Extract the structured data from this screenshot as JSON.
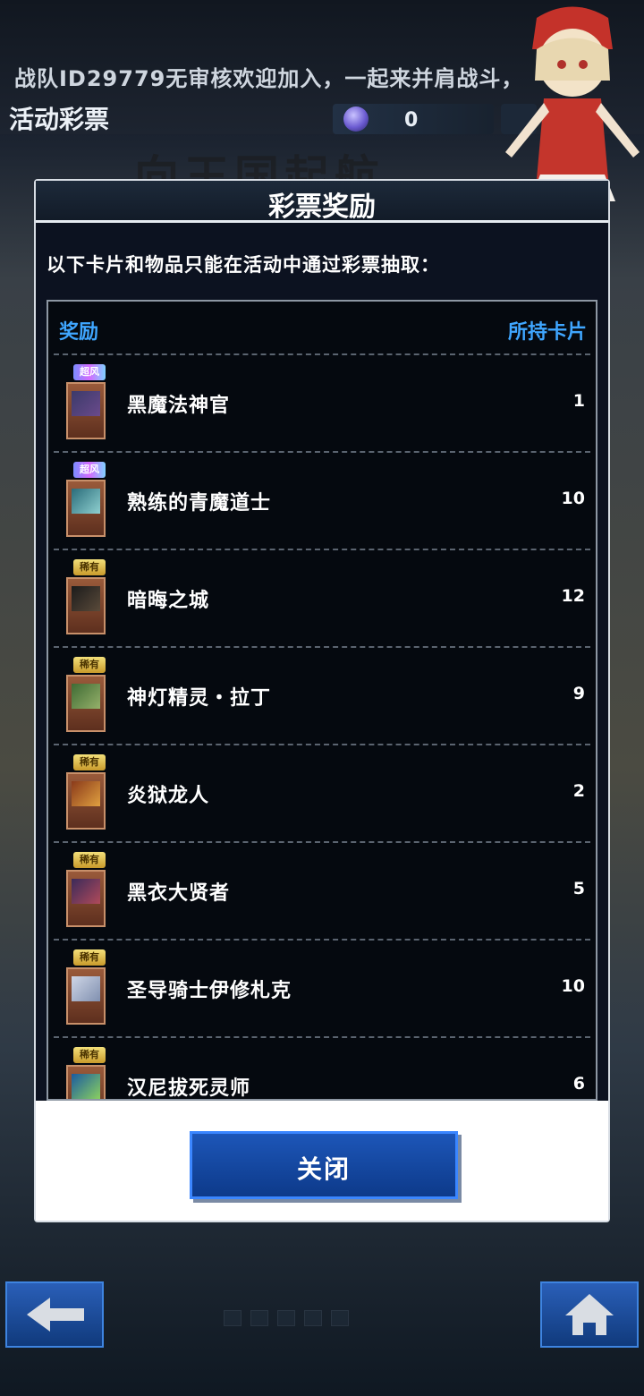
{
  "header": {
    "marquee": "战队ID29779无审核欢迎加入，一起来并肩战斗，",
    "page_title": "活动彩票",
    "currency_value": "0",
    "background_banner": "向王国起航"
  },
  "dialog": {
    "title": "彩票奖励",
    "intro": "以下卡片和物品只能在活动中通过彩票抽取：",
    "columns": {
      "reward": "奖励",
      "owned": "所持卡片"
    },
    "rows": [
      {
        "rarity": "超风",
        "rarity_type": "ur",
        "name": "黑魔法神官",
        "count": "1"
      },
      {
        "rarity": "超风",
        "rarity_type": "ur",
        "name": "熟练的青魔道士",
        "count": "10"
      },
      {
        "rarity": "稀有",
        "rarity_type": "sr",
        "name": "暗晦之城",
        "count": "12"
      },
      {
        "rarity": "稀有",
        "rarity_type": "sr",
        "name": "神灯精灵・拉丁",
        "count": "9"
      },
      {
        "rarity": "稀有",
        "rarity_type": "sr",
        "name": "炎狱龙人",
        "count": "2"
      },
      {
        "rarity": "稀有",
        "rarity_type": "sr",
        "name": "黑衣大贤者",
        "count": "5"
      },
      {
        "rarity": "稀有",
        "rarity_type": "sr",
        "name": "圣导骑士伊修札克",
        "count": "10"
      },
      {
        "rarity": "稀有",
        "rarity_type": "sr",
        "name": "汉尼拔死灵师",
        "count": "6"
      }
    ],
    "close_label": "关闭"
  },
  "nav": {
    "back_icon": "arrow-left-icon",
    "home_icon": "home-icon"
  },
  "colors": {
    "accent_blue": "#3fa6ff",
    "button_blue": "#1d56b8"
  }
}
